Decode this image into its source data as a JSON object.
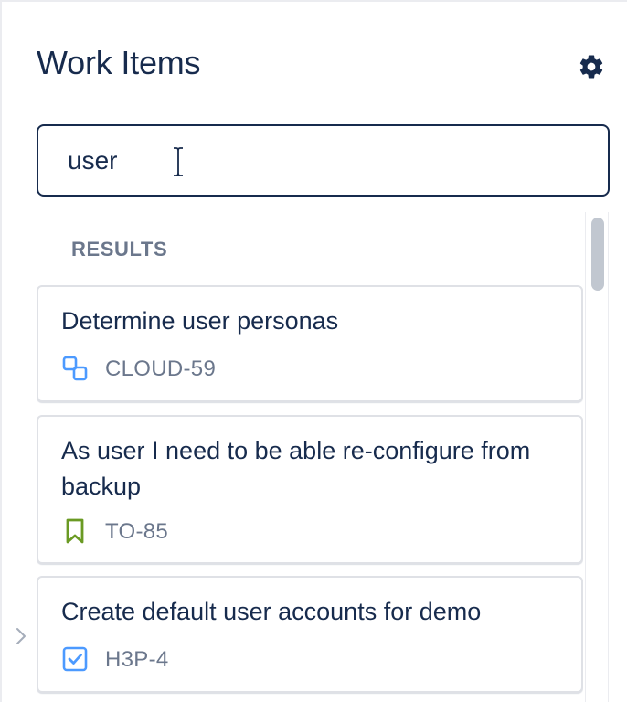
{
  "panel": {
    "title": "Work Items",
    "settings_icon": "gear-icon"
  },
  "search": {
    "value": "user",
    "placeholder": ""
  },
  "results": {
    "heading": "RESULTS",
    "items": [
      {
        "title": "Determine user personas",
        "key": "CLOUD-59",
        "type_icon": "subtask-icon",
        "icon_color": "#4C9AFF"
      },
      {
        "title": "As user I need to be able re-configure from backup",
        "key": "TO-85",
        "type_icon": "story-bookmark-icon",
        "icon_color": "#6A9A23"
      },
      {
        "title": "Create default user accounts for demo",
        "key": "H3P-4",
        "type_icon": "task-checkbox-icon",
        "icon_color": "#4C9AFF"
      }
    ]
  },
  "colors": {
    "text_primary": "#172B4D",
    "text_subtle": "#6B778C",
    "border": "#DFE1E6"
  }
}
